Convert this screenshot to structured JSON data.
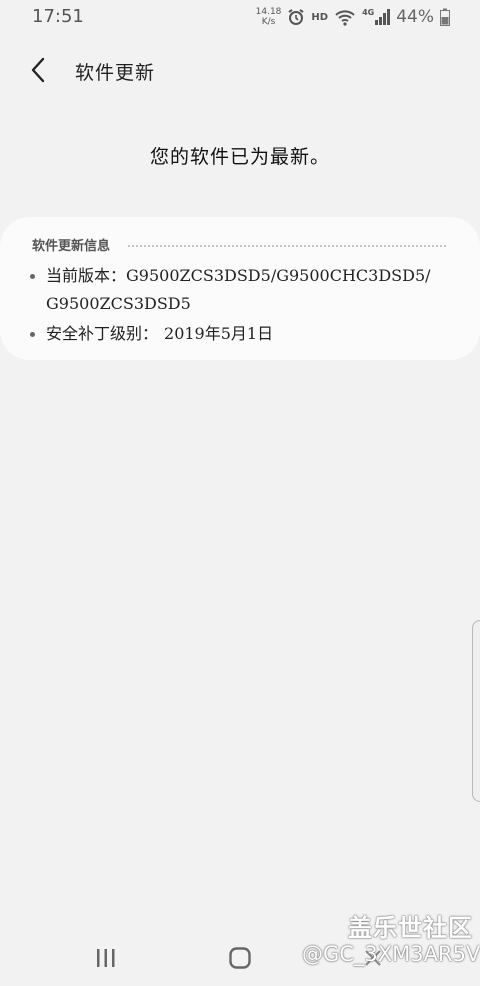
{
  "status_bar": {
    "time": "17:51",
    "net_speed_value": "14.18",
    "net_speed_unit": "K/s",
    "hd": "HD",
    "network": "4G",
    "battery": "44%"
  },
  "header": {
    "title": "软件更新"
  },
  "main": {
    "message": "您的软件已为最新。"
  },
  "info_card": {
    "heading": "软件更新信息",
    "version_label": "当前版本：",
    "version_line1": "G9500ZCS3DSD5/G9500CHC3DSD5/",
    "version_line2": "G9500ZCS3DSD5",
    "patch_label": "安全补丁级别：",
    "patch_value": "2019年5月1日"
  },
  "watermark": {
    "title": "盖乐世社区",
    "user": "@GC_3XM3AR5V"
  },
  "icons": {
    "back": "chevron-left-icon",
    "recents": "recents-icon",
    "home": "home-icon",
    "nav_back": "back-icon"
  }
}
